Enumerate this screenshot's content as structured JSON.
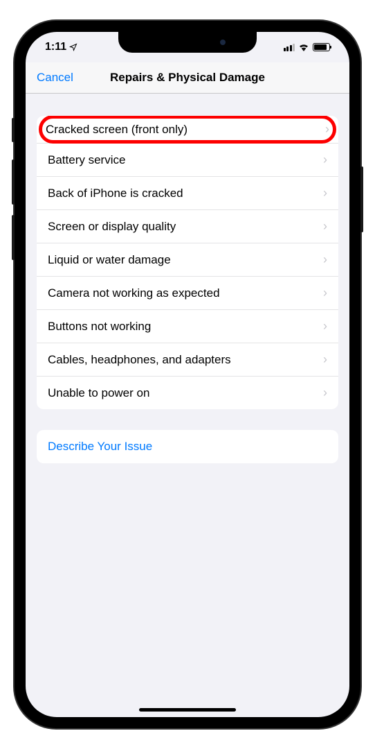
{
  "statusBar": {
    "time": "1:11"
  },
  "nav": {
    "cancel": "Cancel",
    "title": "Repairs & Physical Damage"
  },
  "options": [
    {
      "label": "Cracked screen (front only)",
      "highlighted": true
    },
    {
      "label": "Battery service"
    },
    {
      "label": "Back of iPhone is cracked"
    },
    {
      "label": "Screen or display quality"
    },
    {
      "label": "Liquid or water damage"
    },
    {
      "label": "Camera not working as expected"
    },
    {
      "label": "Buttons not working"
    },
    {
      "label": "Cables, headphones, and adapters"
    },
    {
      "label": "Unable to power on"
    }
  ],
  "describe": {
    "label": "Describe Your Issue"
  }
}
